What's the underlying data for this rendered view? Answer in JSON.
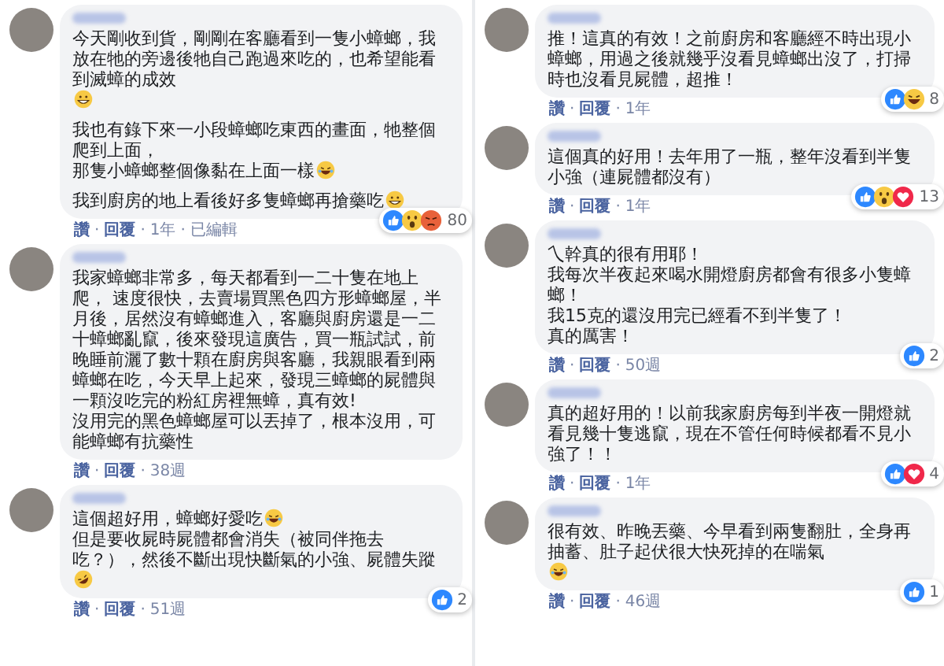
{
  "columns": [
    {
      "comments": [
        {
          "blocks": [
            [
              {
                "text": "今天剛收到貨，剛剛在客廳看到一隻小蟑螂，我放在牠的旁邊後牠自己跑過來吃的，也希望能看到滅蟑的成效",
                "emoji": {
                  "kind": "grin"
                }
              }
            ],
            [
              {
                "text": "我也有錄下來一小段蟑螂吃東西的畫面，牠整個爬到上面，"
              },
              {
                "text": "那隻小蟑螂整個像黏在上面一樣",
                "emoji": {
                  "kind": "laugh"
                }
              }
            ],
            [
              {
                "text": "我到廚房的地上看後好多隻蟑螂再搶藥吃",
                "emoji": {
                  "kind": "grin"
                }
              }
            ]
          ],
          "reactions": {
            "icons": [
              {
                "kind": "like"
              },
              {
                "kind": "wow"
              },
              {
                "kind": "angry"
              }
            ],
            "count": "80"
          },
          "footer": {
            "like": "讚",
            "reply": "回覆",
            "time": "1年",
            "edited": "已編輯",
            "separator": "·"
          }
        },
        {
          "blocks": [
            [
              {
                "text": "我家蟑螂非常多，每天都看到一二十隻在地上爬， 速度很快，去賣場買黑色四方形蟑螂屋，半月後，居然沒有蟑螂進入，客廳與廚房還是一二十蟑螂亂竄，後來發現這廣告，買一瓶試試，前晚睡前灑了數十顆在廚房與客廳，我親眼看到兩蟑螂在吃，今天早上起來，發現三蟑螂的屍體與一顆沒吃完的粉紅房裡無蟑，真有效!"
              },
              {
                "text": "沒用完的黑色蟑螂屋可以丟掉了，根本沒用，可能蟑螂有抗藥性"
              }
            ]
          ],
          "footer": {
            "like": "讚",
            "reply": "回覆",
            "time": "38週",
            "separator": "·"
          }
        },
        {
          "blocks": [
            [
              {
                "text": "這個超好用，蟑螂好愛吃",
                "emoji": {
                  "kind": "laugh"
                }
              },
              {
                "text": "但是要收屍時屍體都會消失（被同伴拖去吃？），然後不斷出現快斷氣的小強、屍體失蹤",
                "emoji": {
                  "kind": "rofl"
                }
              }
            ]
          ],
          "reactions": {
            "icons": [
              {
                "kind": "like"
              }
            ],
            "count": "2"
          },
          "footer": {
            "like": "讚",
            "reply": "回覆",
            "time": "51週",
            "separator": "·"
          }
        }
      ]
    },
    {
      "comments": [
        {
          "blocks": [
            [
              {
                "text": "推！這真的有效！之前廚房和客廳經不時出現小蟑螂，用過之後就幾乎沒看見蟑螂出沒了，打掃時也沒看見屍體，超推！"
              }
            ]
          ],
          "reactions": {
            "icons": [
              {
                "kind": "like"
              },
              {
                "kind": "haha"
              }
            ],
            "count": "8"
          },
          "footer": {
            "like": "讚",
            "reply": "回覆",
            "time": "1年",
            "separator": "·"
          }
        },
        {
          "blocks": [
            [
              {
                "text": "這個真的好用！去年用了一瓶，整年沒看到半隻小強（連屍體都沒有）"
              }
            ]
          ],
          "reactions": {
            "icons": [
              {
                "kind": "like"
              },
              {
                "kind": "wow"
              },
              {
                "kind": "love"
              }
            ],
            "count": "13"
          },
          "footer": {
            "like": "讚",
            "reply": "回覆",
            "time": "1年",
            "separator": "·"
          }
        },
        {
          "blocks": [
            [
              {
                "text": "乀幹真的很有用耶！"
              },
              {
                "text": "我每次半夜起來喝水開燈廚房都會有很多小隻蟑螂！"
              },
              {
                "text": "我15克的還沒用完已經看不到半隻了！"
              },
              {
                "text": "真的厲害！"
              }
            ]
          ],
          "reactions": {
            "icons": [
              {
                "kind": "like"
              }
            ],
            "count": "2"
          },
          "footer": {
            "like": "讚",
            "reply": "回覆",
            "time": "50週",
            "separator": "·"
          }
        },
        {
          "blocks": [
            [
              {
                "text": "真的超好用的！以前我家廚房每到半夜一開燈就看見幾十隻逃竄，現在不管任何時候都看不見小強了！！"
              }
            ]
          ],
          "reactions": {
            "icons": [
              {
                "kind": "like"
              },
              {
                "kind": "love"
              }
            ],
            "count": "4"
          },
          "footer": {
            "like": "讚",
            "reply": "回覆",
            "time": "1年",
            "separator": "·"
          }
        },
        {
          "blocks": [
            [
              {
                "text": "很有效、昨晚丟藥、今早看到兩隻翻肚，全身再抽蓄、肚子起伏很大快死掉的在喘氣",
                "emoji": {
                  "kind": "laugh"
                }
              }
            ]
          ],
          "reactions": {
            "icons": [
              {
                "kind": "like"
              }
            ],
            "count": "1"
          },
          "footer": {
            "like": "讚",
            "reply": "回覆",
            "time": "46週",
            "separator": "·"
          }
        }
      ]
    }
  ]
}
